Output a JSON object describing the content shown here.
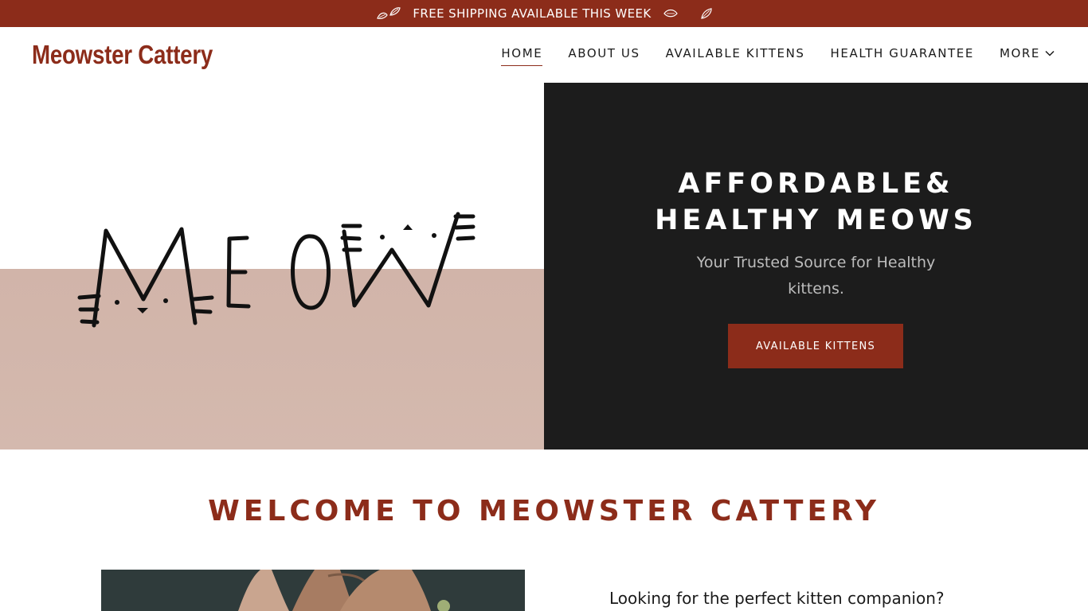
{
  "announcement": {
    "text": "FREE SHIPPING AVAILABLE THIS WEEK"
  },
  "header": {
    "logo": "Meowster Cattery",
    "nav": [
      {
        "label": "HOME",
        "active": true
      },
      {
        "label": "ABOUT US"
      },
      {
        "label": "AVAILABLE KITTENS"
      },
      {
        "label": "HEALTH GUARANTEE"
      },
      {
        "label": "MORE"
      }
    ]
  },
  "hero": {
    "image_text": "MEOW",
    "title_line1": "AFFORDABLE&",
    "title_line2": "HEALTHY MEOWS",
    "subtitle": "Your Trusted Source for Healthy kittens.",
    "button_label": "AVAILABLE KITTENS"
  },
  "welcome": {
    "heading": "WELCOME TO MEOWSTER CATTERY",
    "intro": "Looking for the perfect kitten companion?"
  },
  "colors": {
    "brand": "#8c2c1a",
    "dark": "#1c1c1c",
    "hero_pink": "#d1b4a9"
  }
}
